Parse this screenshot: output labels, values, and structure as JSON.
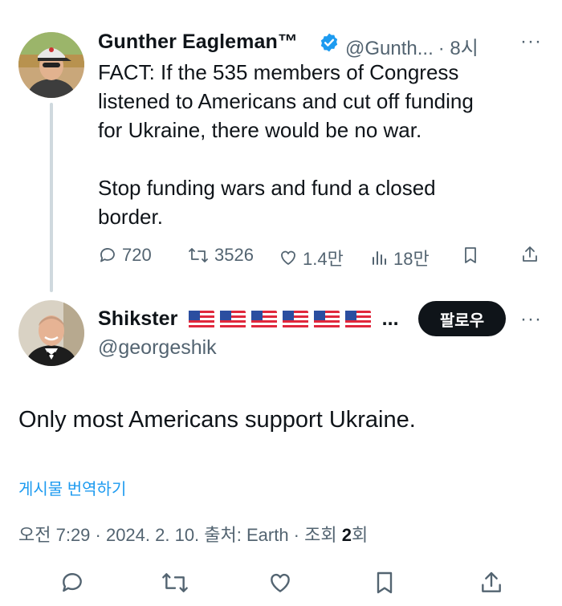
{
  "tweet1": {
    "author_name": "Gunther Eagleman™",
    "handle": "@Gunth...",
    "time": "· 8시",
    "text": "FACT:  If the 535 members of Congress\nlistened to Americans and cut off funding\nfor Ukraine,  there would be no war.\n\nStop funding wars and fund a closed\nborder.",
    "stats": {
      "replies": "720",
      "reposts": "3526",
      "likes": "1.4만",
      "views": "18만"
    },
    "more": "···"
  },
  "tweet2": {
    "author_name": "Shikster",
    "flags": "🇺🇸🇺🇸🇺🇸🇺🇸🇺🇸🇺🇸",
    "name_ellipsis": "...",
    "handle": "@georgeshik",
    "follow_label": "팔로우",
    "more": "···",
    "text": "Only most Americans support Ukraine.",
    "translate_label": "게시물 번역하기",
    "meta": {
      "prefix": "오전 7:29 · 2024. 2. 10. 출처: Earth · 조회 ",
      "count": "2",
      "suffix": "회"
    }
  },
  "icons": [
    "reply-icon",
    "repost-icon",
    "like-icon",
    "views-icon",
    "bookmark-icon",
    "share-icon",
    "verified-icon",
    "more-icon"
  ],
  "colors": {
    "verified": "#1d9bf0",
    "muted": "#536471",
    "link": "#1d9bf0",
    "thread_line": "#cfd9de"
  }
}
